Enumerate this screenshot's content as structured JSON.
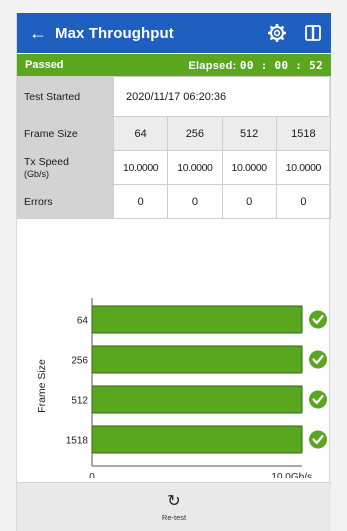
{
  "header": {
    "title": "Max Throughput"
  },
  "status": {
    "result": "Passed",
    "elapsed_label": "Elapsed:",
    "elapsed_time": "00 : 00 : 52"
  },
  "test_started": {
    "label": "Test Started",
    "value": "2020/11/17 06:20:36"
  },
  "frame_size": {
    "label": "Frame Size",
    "values": [
      "64",
      "256",
      "512",
      "1518"
    ]
  },
  "tx_speed": {
    "label": "Tx Speed",
    "unit": "(Gb/s)",
    "values": [
      "10.0000",
      "10.0000",
      "10.0000",
      "10.0000"
    ]
  },
  "errors": {
    "label": "Errors",
    "values": [
      "0",
      "0",
      "0",
      "0"
    ]
  },
  "footer": {
    "retest_label": "Re-test"
  },
  "colors": {
    "header": "#1f5fbf",
    "status": "#5aa71f",
    "bar": "#5aa71f",
    "check": "#5aa71f"
  },
  "chart_data": {
    "type": "bar",
    "orientation": "horizontal",
    "categories": [
      "64",
      "256",
      "512",
      "1518"
    ],
    "values": [
      10.0,
      10.0,
      10.0,
      10.0
    ],
    "ylabel": "Frame Size",
    "xlabel": "",
    "xlim": [
      0,
      10.0
    ],
    "xticks": [
      "0",
      "10.0Gb/s"
    ],
    "status_icons": [
      "check-icon",
      "check-icon",
      "check-icon",
      "check-icon"
    ]
  }
}
